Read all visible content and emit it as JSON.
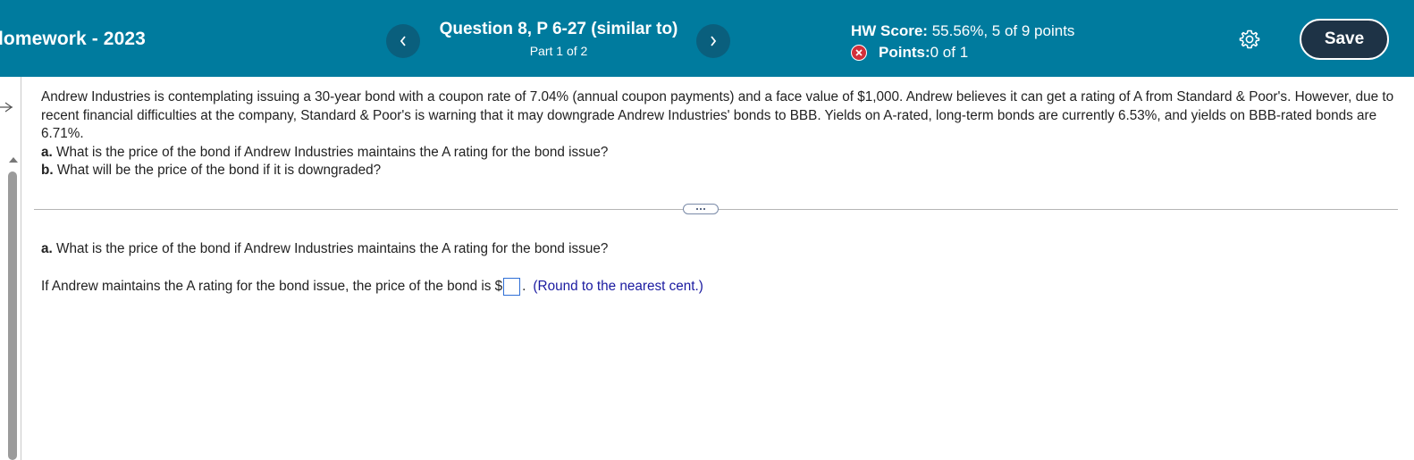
{
  "header": {
    "assignment_title": "lomework - 2023",
    "question_title": "Question 8, P 6-27 (similar to)",
    "question_part": "Part 1 of 2",
    "hw_score_label": "HW Score:",
    "hw_score_value": " 55.56%, 5 of 9 points",
    "points_label": "Points:",
    "points_value": " 0 of 1",
    "save_label": "Save",
    "prev_icon": "chevron-left-icon",
    "next_icon": "chevron-right-icon",
    "settings_icon": "gear-icon",
    "accent_color": "#007b9e",
    "status_color": "#d32f3a"
  },
  "problem": {
    "text": "Andrew Industries is contemplating issuing a 30-year bond with a coupon rate of 7.04% (annual coupon payments) and a face value of $1,000. Andrew believes it can get a rating of A from Standard & Poor's. However, due to recent financial difficulties at the company, Standard & Poor's is warning that it may downgrade Andrew Industries' bonds to BBB. Yields on A-rated, long-term bonds are currently 6.53%, and yields on BBB-rated bonds are 6.71%.",
    "a_label": "a.",
    "a_text": " What is the price of the bond if Andrew Industries maintains the A rating for the bond issue?",
    "b_label": "b.",
    "b_text": " What will be the price of the bond if it is downgraded?"
  },
  "answer_section": {
    "a_label": "a.",
    "a_text": " What is the price of the bond if Andrew Industries maintains the A rating for the bond issue?",
    "prompt": "If Andrew maintains the A rating for the bond issue, the price of the bond is $",
    "input_value": "",
    "after_input": ".",
    "hint": "(Round to the nearest cent.)"
  }
}
